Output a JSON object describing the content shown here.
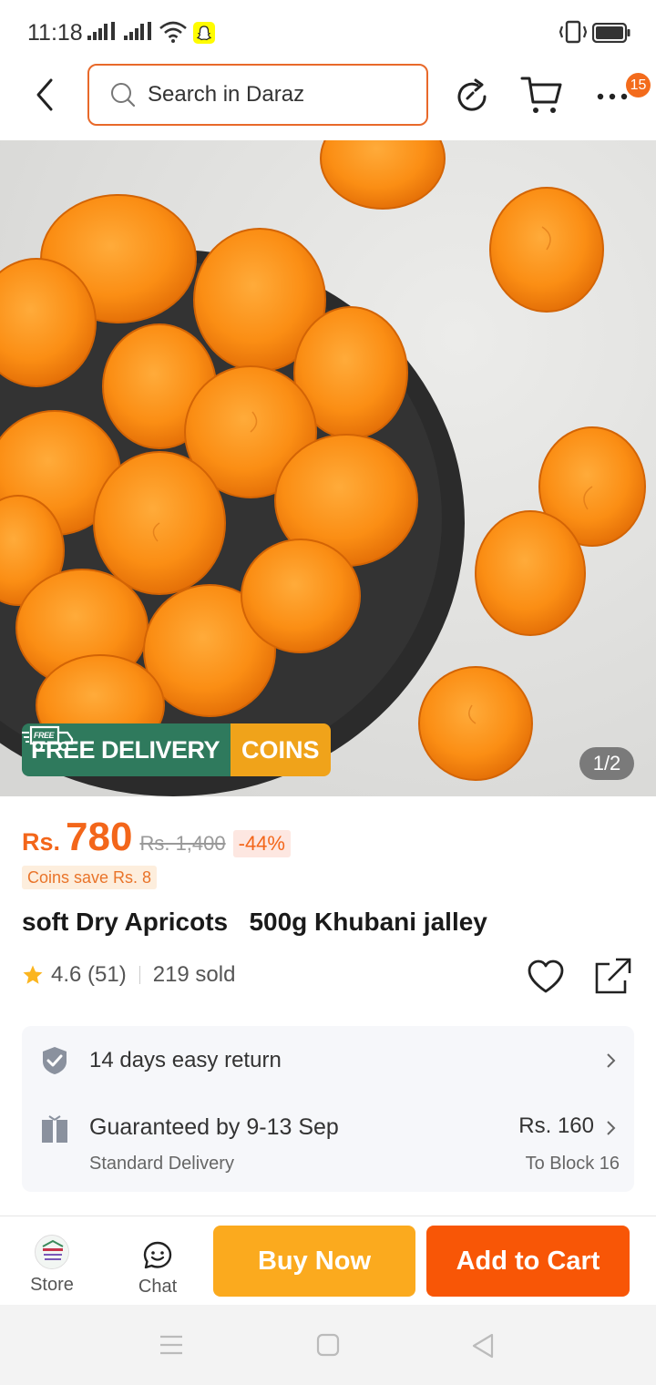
{
  "status_bar": {
    "time": "11:18"
  },
  "header": {
    "search_placeholder": "Search in Daraz",
    "more_badge": "15"
  },
  "gallery": {
    "free_delivery": "FREE DELIVERY",
    "truck_badge": "FREE",
    "coins": "COINS",
    "pager": "1/2"
  },
  "price": {
    "currency": "Rs.",
    "value": "780",
    "original": "Rs. 1,400",
    "discount": "-44%",
    "coins_save": "Coins save Rs. 8"
  },
  "product": {
    "title": "soft Dry Apricots   500g Khubani jalley",
    "rating": "4.6 (51)",
    "sold": "219 sold"
  },
  "info": {
    "return_text": "14 days easy return",
    "delivery_title": "Guaranteed by 9-13 Sep",
    "delivery_type": "Standard Delivery",
    "delivery_price": "Rs. 160",
    "delivery_location": "To Block 16"
  },
  "bottom_bar": {
    "store_label": "Store",
    "chat_label": "Chat",
    "buy_now_label": "Buy Now",
    "add_to_cart_label": "Add to Cart"
  },
  "colors": {
    "brand_orange": "#f85606",
    "buy_now": "#fbaa1e",
    "free_delivery_green": "#2f7a5d",
    "coins_yellow": "#f0a31a"
  }
}
